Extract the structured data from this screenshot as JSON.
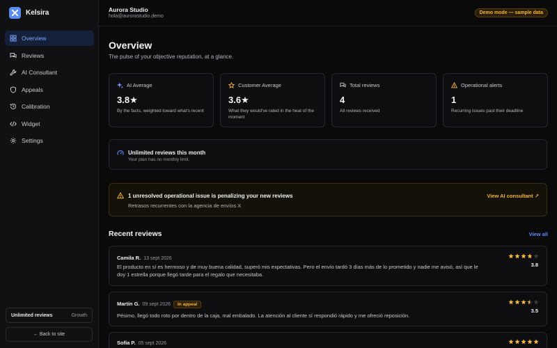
{
  "brand": {
    "name": "Kelsira",
    "logo_icon": "x-mark-icon",
    "accent": "#5b8cf5"
  },
  "sidebar": {
    "items": [
      {
        "label": "Overview",
        "icon": "grid-icon",
        "active": true
      },
      {
        "label": "Reviews",
        "icon": "chat-icon",
        "active": false
      },
      {
        "label": "AI Consultant",
        "icon": "wrench-icon",
        "active": false
      },
      {
        "label": "Appeals",
        "icon": "shield-icon",
        "active": false
      },
      {
        "label": "Calibration",
        "icon": "history-icon",
        "active": false
      },
      {
        "label": "Widget",
        "icon": "code-icon",
        "active": false
      },
      {
        "label": "Settings",
        "icon": "gear-icon",
        "active": false
      }
    ],
    "plan_label": "Unlimited reviews",
    "plan_tier": "Growth",
    "back_label": "← Back to site"
  },
  "header": {
    "org_name": "Aurora Studio",
    "org_email": "hola@aurorastudio.demo",
    "demo_badge": "Demo mode — sample data"
  },
  "main": {
    "title": "Overview",
    "subtitle": "The pulse of your objective reputation, at a glance.",
    "stats": [
      {
        "label": "AI Average",
        "icon": "sparkle-icon",
        "value": "3.8★",
        "desc": "By the facts, weighted toward what's recent"
      },
      {
        "label": "Customer Average",
        "icon": "star-outline-icon",
        "value": "3.6★",
        "desc": "What they would've rated in the heat of the moment"
      },
      {
        "label": "Total reviews",
        "icon": "chat-icon",
        "value": "4",
        "desc": "All reviews received"
      },
      {
        "label": "Operational alerts",
        "icon": "warning-icon",
        "value": "1",
        "desc": "Recurring issues past their deadline"
      }
    ],
    "unlimited": {
      "title": "Unlimited reviews this month",
      "subtitle": "Your plan has no monthly limit."
    },
    "alert": {
      "title": "1 unresolved operational issue is penalizing your new reviews",
      "subtitle": "Retrasos recurrentes con la agencia de envíos X",
      "link": "View AI consultant ↗"
    },
    "recent_title": "Recent reviews",
    "view_all": "View all",
    "reviews": [
      {
        "name": "Camila R.",
        "date": "13 sept 2026",
        "badge": "",
        "text": "El producto en sí es hermoso y de muy buena calidad, superó mis expectativas. Pero el envío tardó 3 días más de lo prometido y nadie me avisó, así que le doy 1 estrella porque llegó tarde para el regalo que necesitaba.",
        "rating": "3.8",
        "rating_value": 3.8
      },
      {
        "name": "Martín G.",
        "date": "09 sept 2026",
        "badge": "In appeal",
        "text": "Pésimo, llegó todo roto por dentro de la caja, mal embalado. La atención al cliente sí respondió rápido y me ofreció reposición.",
        "rating": "3.5",
        "rating_value": 3.5
      },
      {
        "name": "Sofía P.",
        "date": "05 sept 2026",
        "badge": "",
        "text": "",
        "rating": "",
        "rating_value": 5
      }
    ]
  },
  "colors": {
    "star": "#f3b43a",
    "star_empty": "#3a3a40",
    "warning": "#f3b43a"
  }
}
